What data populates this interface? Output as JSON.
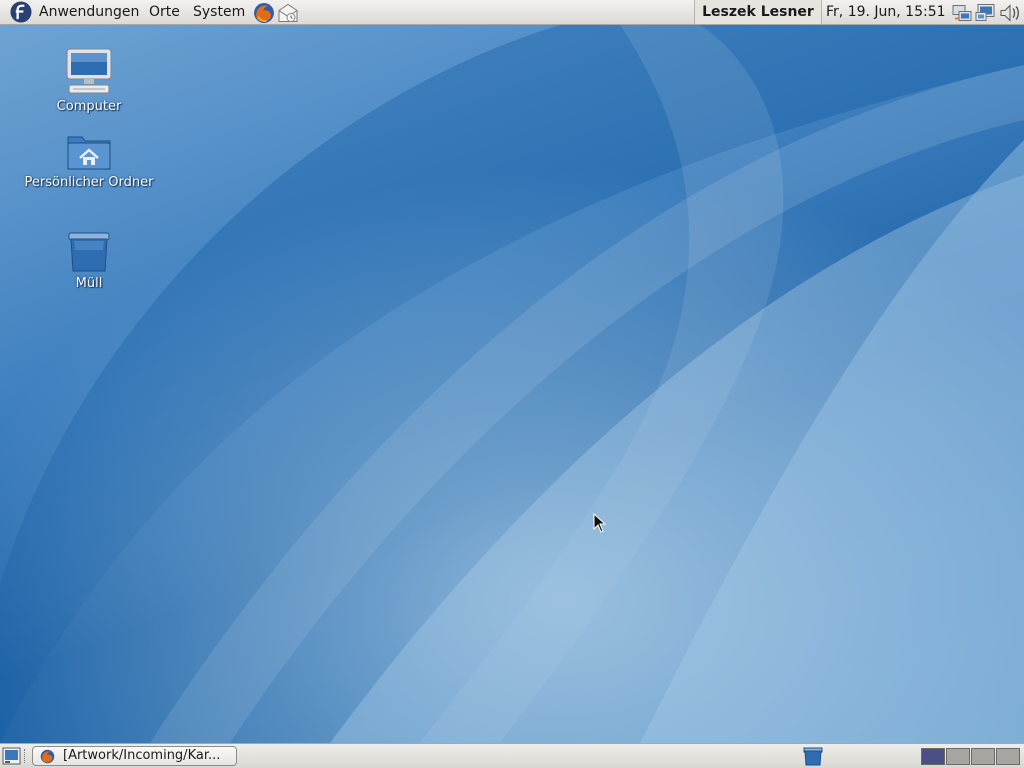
{
  "top_panel": {
    "menus": [
      {
        "label": "Anwendungen"
      },
      {
        "label": "Orte"
      },
      {
        "label": "System"
      }
    ],
    "launchers": [
      {
        "icon": "firefox-icon"
      },
      {
        "icon": "mail-icon"
      }
    ],
    "user_name": "Leszek Lesner",
    "clock": "Fr, 19. Jun, 15:51",
    "tray": [
      {
        "icon": "network-icon"
      },
      {
        "icon": "display-icon"
      },
      {
        "icon": "volume-icon"
      }
    ]
  },
  "desktop": {
    "icons": [
      {
        "label": "Computer",
        "icon": "computer-icon"
      },
      {
        "label": "Persönlicher Ordner",
        "icon": "home-folder-icon"
      },
      {
        "label": "Müll",
        "icon": "trash-icon"
      }
    ]
  },
  "bottom_panel": {
    "show_desktop_icon": "show-desktop-icon",
    "task": {
      "label": "[Artwork/Incoming/Kar...",
      "icon": "firefox-icon"
    },
    "trash_icon": "trash-icon",
    "workspaces": [
      {
        "active": true,
        "color": "#4a4f86"
      },
      {
        "active": false,
        "color": "#a7a5a0"
      },
      {
        "active": false,
        "color": "#a7a5a0"
      },
      {
        "active": false,
        "color": "#a7a5a0"
      }
    ]
  },
  "colors": {
    "wallpaper_dark": "#1c62a6",
    "wallpaper_light": "#9cc3e3",
    "panel": "#dcdad5",
    "workspace_active": "#4a4f86"
  }
}
